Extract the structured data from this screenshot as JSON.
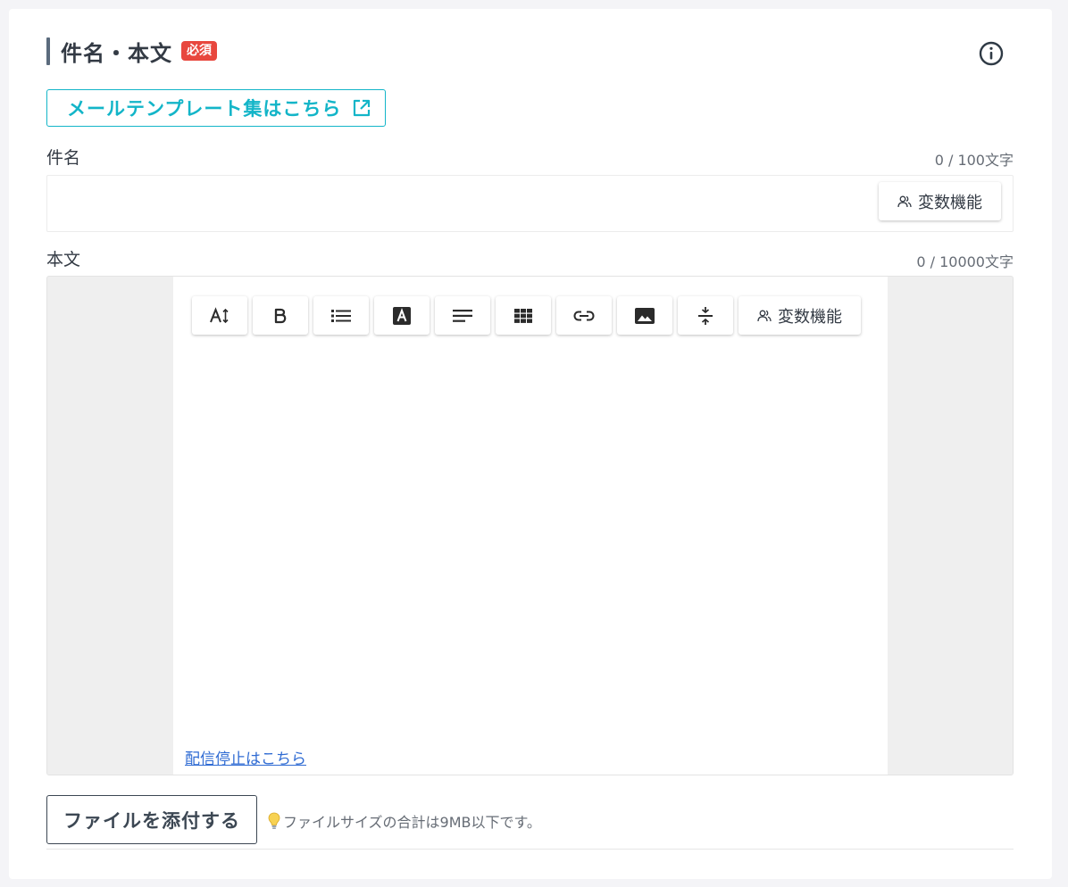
{
  "section": {
    "title": "件名・本文",
    "badge": "必須"
  },
  "template_link": {
    "label": "メールテンプレート集はこちら"
  },
  "subject": {
    "label": "件名",
    "counter": "0 / 100文字",
    "value": "",
    "variable_button": "変数機能"
  },
  "body": {
    "label": "本文",
    "counter": "0 / 10000文字",
    "toolbar": [
      {
        "name": "font-size-icon"
      },
      {
        "name": "bold-icon"
      },
      {
        "name": "bullet-list-icon"
      },
      {
        "name": "text-color-icon"
      },
      {
        "name": "align-icon"
      },
      {
        "name": "table-icon"
      },
      {
        "name": "link-icon"
      },
      {
        "name": "image-icon"
      },
      {
        "name": "divider-icon"
      }
    ],
    "variable_button": "変数機能",
    "unsubscribe_link": "配信停止はこちら"
  },
  "attach": {
    "button": "ファイルを添付する",
    "hint": "ファイルサイズの合計は9MB以下です。"
  },
  "colors": {
    "accent": "#13b5c8",
    "badge": "#e8473e",
    "link": "#2f6bd3"
  }
}
